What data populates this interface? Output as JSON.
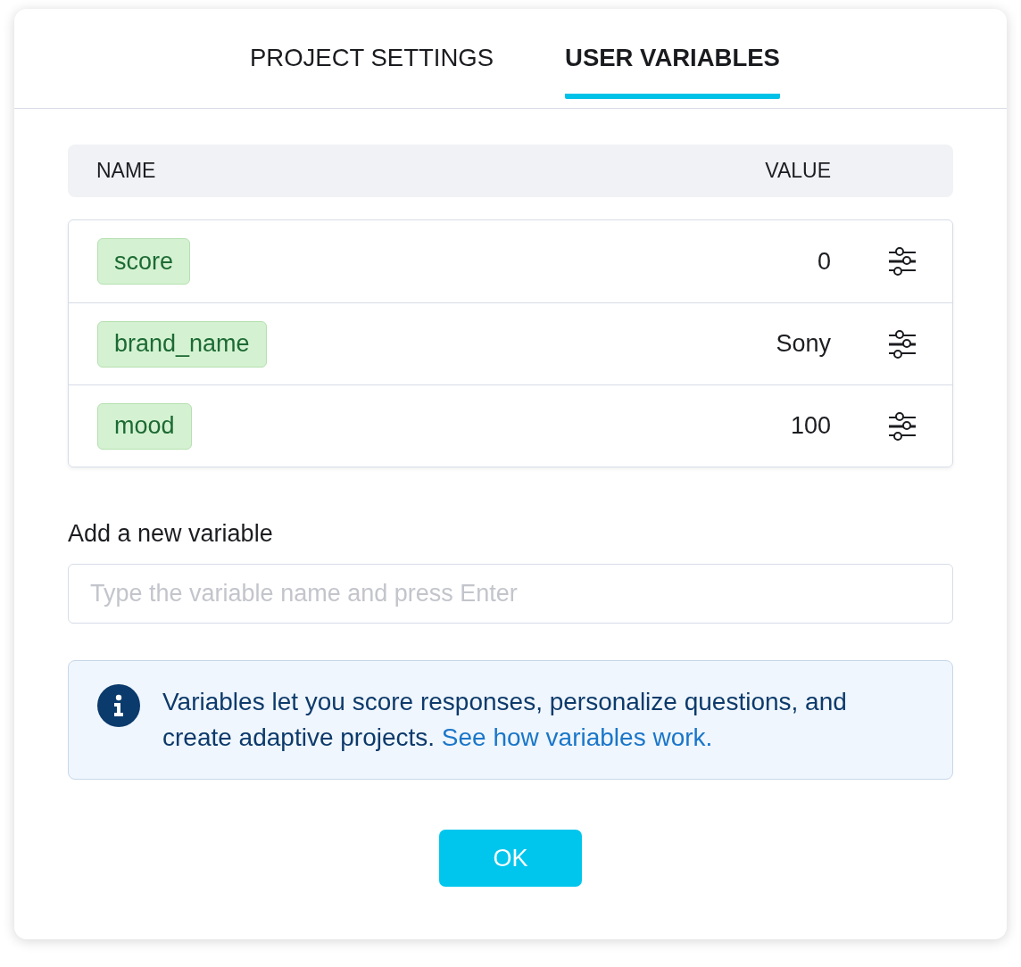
{
  "tabs": [
    {
      "label": "PROJECT SETTINGS",
      "selected": false
    },
    {
      "label": "USER VARIABLES",
      "selected": true
    }
  ],
  "table": {
    "columns": [
      "NAME",
      "VALUE"
    ],
    "rows": [
      {
        "name": "score",
        "value": "0"
      },
      {
        "name": "brand_name",
        "value": "Sony"
      },
      {
        "name": "mood",
        "value": "100"
      }
    ]
  },
  "new_variable": {
    "label": "Add a new variable",
    "placeholder": "Type the variable name and press Enter"
  },
  "info": {
    "text": "Variables let you score responses, personalize questions, and create adaptive projects.",
    "link": "See how variables work."
  },
  "buttons": [
    {
      "label": "OK"
    }
  ]
}
